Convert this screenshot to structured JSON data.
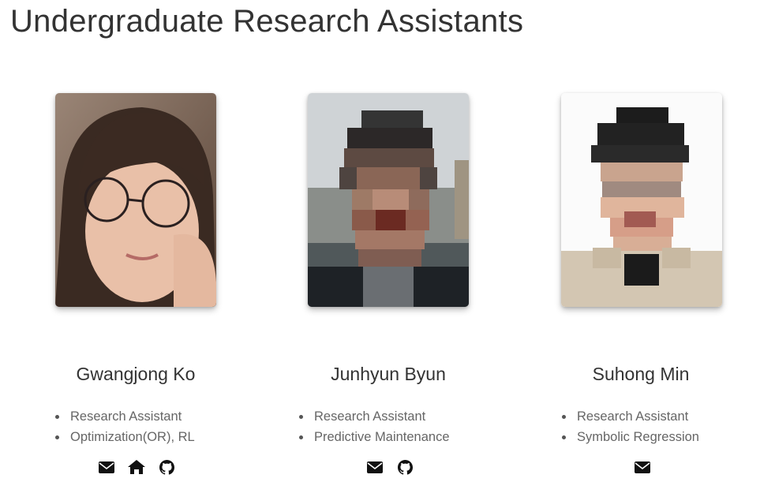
{
  "section": {
    "title": "Undergraduate Research Assistants"
  },
  "members": [
    {
      "name": "Gwangjong Ko",
      "roles": [
        "Research Assistant",
        "Optimization(OR), RL"
      ],
      "links": [
        "email-icon",
        "home-icon",
        "github-icon"
      ]
    },
    {
      "name": "Junhyun Byun",
      "roles": [
        "Research Assistant",
        "Predictive Maintenance"
      ],
      "links": [
        "email-icon",
        "github-icon"
      ]
    },
    {
      "name": "Suhong Min",
      "roles": [
        "Research Assistant",
        "Symbolic Regression"
      ],
      "links": [
        "email-icon"
      ]
    }
  ],
  "colors": {
    "text": "#333333",
    "muted": "#666666",
    "icon": "#111111"
  }
}
